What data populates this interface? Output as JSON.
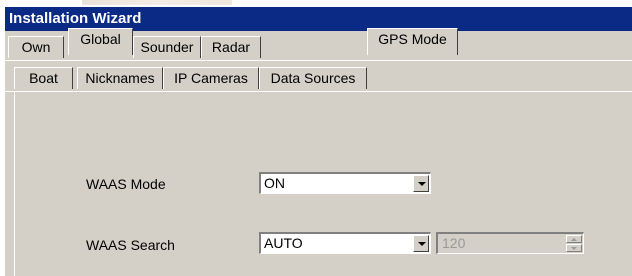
{
  "window": {
    "title": "Installation Wizard"
  },
  "tabs_row1": [
    {
      "label": "Own",
      "active": false
    },
    {
      "label": "Global",
      "active": true
    },
    {
      "label": "Sounder",
      "active": false
    },
    {
      "label": "Radar",
      "active": false
    }
  ],
  "tabs_row2": [
    {
      "label": "Boat",
      "active": false
    },
    {
      "label": "Nicknames",
      "active": false
    },
    {
      "label": "IP Cameras",
      "active": false
    },
    {
      "label": "Data Sources",
      "active": false
    },
    {
      "label": "GPS Mode",
      "active": true
    }
  ],
  "gps_mode": {
    "waas_mode": {
      "label": "WAAS Mode",
      "value": "ON"
    },
    "waas_search": {
      "label": "WAAS Search",
      "value": "AUTO",
      "spinner_value": "120",
      "spinner_enabled": false
    }
  },
  "colors": {
    "titlebar": "#0a2a86",
    "face": "#d4d0c8"
  }
}
